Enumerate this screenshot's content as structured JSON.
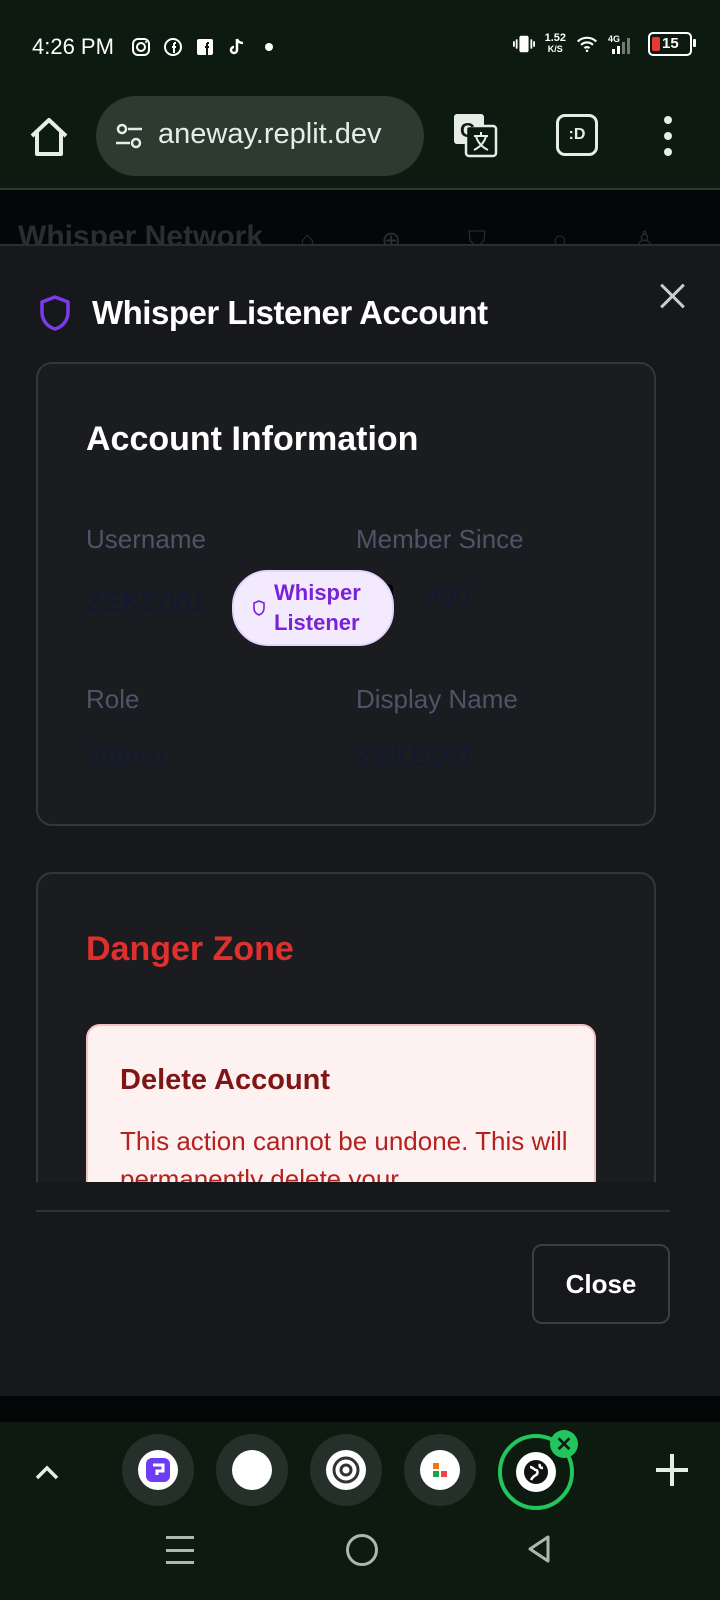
{
  "status_bar": {
    "time": "4:26 PM",
    "net_speed_value": "1.52",
    "net_speed_unit": "K/S",
    "network_type": "4G",
    "battery_level": "15",
    "icons": [
      "instagram-icon",
      "facebook-icon",
      "facebook-square-icon",
      "tiktok-icon",
      "dot-icon",
      "vibrate-icon",
      "wifi-icon",
      "signal-icon",
      "battery-icon"
    ]
  },
  "browser": {
    "url": "aneway.replit.dev",
    "tabs_button_label": ":D"
  },
  "background_page": {
    "title": "Whisper Network"
  },
  "modal": {
    "title": "Whisper Listener Account",
    "account_info": {
      "heading": "Account Information",
      "username_label": "Username",
      "username_value": "ZEKE001",
      "member_since_label": "Member Since",
      "member_since_overlay": "8m",
      "member_since_value": "ago",
      "badge_label_line1": "Whisper",
      "badge_label_line2": "Listener",
      "role_label": "Role",
      "role_value": "Admin",
      "display_name_label": "Display Name",
      "display_name_value": "ZEKE001"
    },
    "danger_zone": {
      "heading": "Danger Zone",
      "delete_title": "Delete Account",
      "delete_text": "This action cannot be undone. This will permanently delete your"
    },
    "close_button_label": "Close"
  },
  "colors": {
    "accent_purple": "#7c3aed",
    "danger_red": "#e0302e",
    "active_tab_green": "#22c55e"
  }
}
